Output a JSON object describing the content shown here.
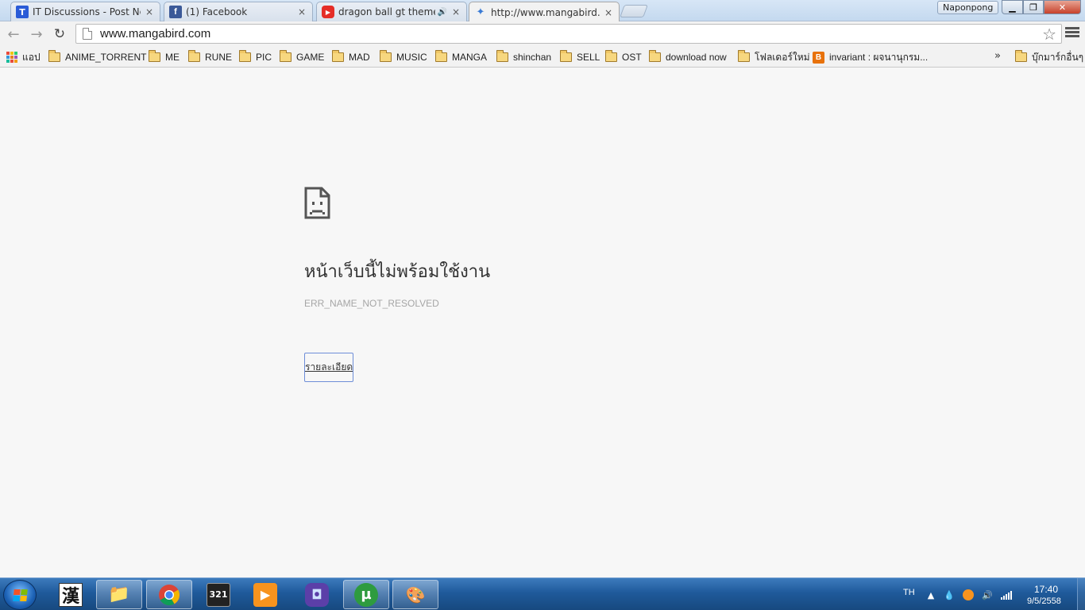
{
  "window": {
    "profile_name": "Naponpong",
    "minimize_glyph": "▁",
    "maximize_glyph": "❐",
    "close_glyph": "✕"
  },
  "tabs": [
    {
      "title": "IT Discussions - Post New",
      "favicon": "T",
      "favicon_name": "it-discussions-favicon",
      "close": "×"
    },
    {
      "title": "(1) Facebook",
      "favicon": "f",
      "favicon_name": "facebook-icon",
      "close": "×"
    },
    {
      "title": "dragon ball gt theme s",
      "favicon": "▶",
      "favicon_name": "youtube-icon",
      "audio": "🔊",
      "close": "×"
    },
    {
      "title": "http://www.mangabird.co",
      "favicon": "✦",
      "favicon_name": "bird-icon",
      "close": "×"
    }
  ],
  "toolbar": {
    "back_glyph": "←",
    "forward_glyph": "→",
    "reload_glyph": "↻",
    "url": "www.mangabird.com",
    "star_glyph": "☆"
  },
  "bookmarks": {
    "apps_label": "แอป",
    "items": [
      "ANIME_TORRENT",
      "ME",
      "RUNE",
      "PIC",
      "GAME",
      "MAD",
      "MUSIC",
      "MANGA",
      "shinchan",
      "SELL",
      "OST",
      "download now",
      "โฟลเดอร์ใหม่"
    ],
    "blogger_label": "invariant : ผจนานุกรม...",
    "overflow_glyph": "»",
    "other_label": "บุ๊กมาร์กอื่นๆ"
  },
  "error": {
    "heading": "หน้าเว็บนี้ไม่พร้อมใช้งาน",
    "code": "ERR_NAME_NOT_RESOLVED",
    "details_label": "รายละเอียด"
  },
  "taskbar": {
    "apps": [
      {
        "name": "kanji-app",
        "glyph": "漢"
      },
      {
        "name": "file-explorer",
        "glyph": "📁"
      },
      {
        "name": "chrome",
        "glyph": ""
      },
      {
        "name": "media-player-classic",
        "glyph": "321"
      },
      {
        "name": "media-player",
        "glyph": "▶"
      },
      {
        "name": "gba-emulator",
        "glyph": "◘"
      },
      {
        "name": "utorrent",
        "glyph": "µ"
      },
      {
        "name": "paint",
        "glyph": "🎨"
      }
    ],
    "language": "TH",
    "clock_time": "17:40",
    "clock_date": "9/5/2558"
  },
  "colors": {
    "page_background": "#f7f7f7",
    "taskbar_blue": "#1f5a9b",
    "details_border": "#6e8ed8",
    "error_code_gray": "#a6a6a6"
  }
}
